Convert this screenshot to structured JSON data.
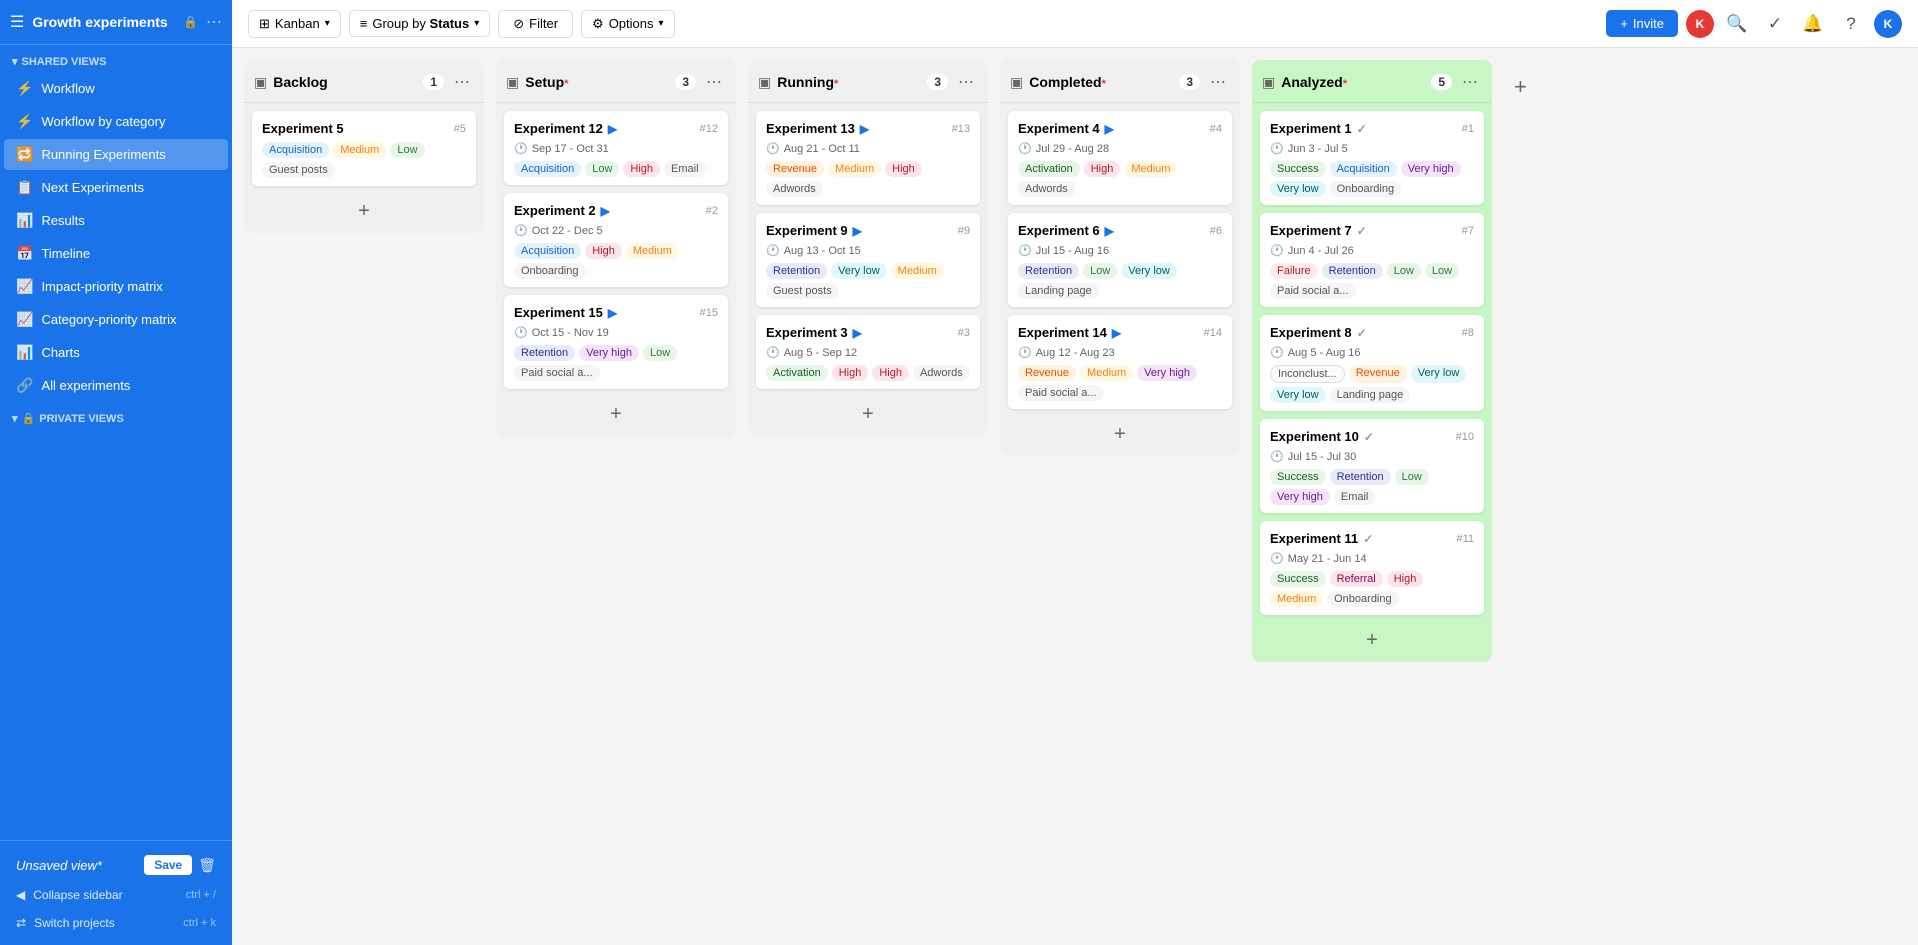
{
  "app": {
    "title": "Growth experiments",
    "title_icon": "🔒"
  },
  "topbar": {
    "kanban_label": "Kanban",
    "group_by_label": "Group by",
    "group_by_field": "Status",
    "filter_label": "Filter",
    "options_label": "Options",
    "invite_label": "Invite"
  },
  "sidebar": {
    "shared_views_label": "SHARED VIEWS",
    "private_views_label": "PRIVATE VIEWS",
    "items": [
      {
        "id": "workflow",
        "label": "Workflow",
        "icon": "⚡"
      },
      {
        "id": "workflow-category",
        "label": "Workflow by category",
        "icon": "⚡"
      },
      {
        "id": "running",
        "label": "Running Experiments",
        "icon": "🔁",
        "active": true
      },
      {
        "id": "next",
        "label": "Next Experiments",
        "icon": "📋"
      },
      {
        "id": "results",
        "label": "Results",
        "icon": "📊"
      },
      {
        "id": "timeline",
        "label": "Timeline",
        "icon": "📅"
      },
      {
        "id": "impact-matrix",
        "label": "Impact-priority matrix",
        "icon": "📈"
      },
      {
        "id": "category-matrix",
        "label": "Category-priority matrix",
        "icon": "📈"
      },
      {
        "id": "charts",
        "label": "Charts",
        "icon": "📊"
      },
      {
        "id": "all",
        "label": "All experiments",
        "icon": "🔗"
      }
    ],
    "unsaved_label": "Unsaved view*",
    "save_label": "Save",
    "collapse_label": "Collapse sidebar",
    "collapse_shortcut": "ctrl + /",
    "switch_label": "Switch projects",
    "switch_shortcut": "ctrl + k"
  },
  "columns": [
    {
      "id": "backlog",
      "title": "Backlog",
      "count": 1,
      "color": "default",
      "cards": [
        {
          "id": "exp5",
          "title": "Experiment 5",
          "num": "#5",
          "has_play": false,
          "has_check": false,
          "date": null,
          "tags": [
            "Acquisition",
            "Medium",
            "Low",
            "Guest posts"
          ]
        }
      ]
    },
    {
      "id": "setup",
      "title": "Setup",
      "has_asterisk": true,
      "count": 3,
      "color": "default",
      "cards": [
        {
          "id": "exp12",
          "title": "Experiment 12",
          "num": "#12",
          "has_play": true,
          "date": "Sep 17 - Oct 31",
          "tags": [
            "Acquisition",
            "Low",
            "High",
            "Email"
          ]
        },
        {
          "id": "exp2",
          "title": "Experiment 2",
          "num": "#2",
          "has_play": true,
          "date": "Oct 22 - Dec 5",
          "tags": [
            "Acquisition",
            "High",
            "Medium",
            "Onboarding"
          ]
        },
        {
          "id": "exp15",
          "title": "Experiment 15",
          "num": "#15",
          "has_play": true,
          "date": "Oct 15 - Nov 19",
          "tags": [
            "Retention",
            "Very high",
            "Low",
            "Paid social a..."
          ]
        }
      ]
    },
    {
      "id": "running",
      "title": "Running",
      "has_asterisk": true,
      "count": 3,
      "color": "default",
      "cards": [
        {
          "id": "exp13",
          "title": "Experiment 13",
          "num": "#13",
          "has_play": true,
          "date": "Aug 21 - Oct 11",
          "tags": [
            "Revenue",
            "Medium",
            "High",
            "Adwords"
          ]
        },
        {
          "id": "exp9",
          "title": "Experiment 9",
          "num": "#9",
          "has_play": true,
          "date": "Aug 13 - Oct 15",
          "tags": [
            "Retention",
            "Very low",
            "Medium",
            "Guest posts"
          ]
        },
        {
          "id": "exp3",
          "title": "Experiment 3",
          "num": "#3",
          "has_play": true,
          "date": "Aug 5 - Sep 12",
          "tags": [
            "Activation",
            "High",
            "High",
            "Adwords"
          ]
        }
      ]
    },
    {
      "id": "completed",
      "title": "Completed",
      "has_asterisk": true,
      "count": 3,
      "color": "default",
      "cards": [
        {
          "id": "exp4",
          "title": "Experiment 4",
          "num": "#4",
          "has_play": true,
          "date": "Jul 29 - Aug 28",
          "tags": [
            "Activation",
            "High",
            "Medium",
            "Adwords"
          ]
        },
        {
          "id": "exp6",
          "title": "Experiment 6",
          "num": "#6",
          "has_play": true,
          "date": "Jul 15 - Aug 16",
          "tags": [
            "Retention",
            "Low",
            "Very low",
            "Landing page"
          ]
        },
        {
          "id": "exp14",
          "title": "Experiment 14",
          "num": "#14",
          "has_play": true,
          "date": "Aug 12 - Aug 23",
          "tags": [
            "Revenue",
            "Medium",
            "Very high",
            "Paid social a..."
          ]
        }
      ]
    },
    {
      "id": "analyzed",
      "title": "Analyzed",
      "has_asterisk": true,
      "count": 5,
      "color": "green",
      "cards": [
        {
          "id": "exp1",
          "title": "Experiment 1",
          "num": "#1",
          "has_check": true,
          "date": "Jun 3 - Jul 5",
          "tags": [
            "Success",
            "Acquisition",
            "Very high",
            "Very low",
            "Onboarding"
          ]
        },
        {
          "id": "exp7",
          "title": "Experiment 7",
          "num": "#7",
          "has_check": true,
          "date": "Jun 4 - Jul 26",
          "tags": [
            "Failure",
            "Retention",
            "Low",
            "Low",
            "Paid social a..."
          ]
        },
        {
          "id": "exp8",
          "title": "Experiment 8",
          "num": "#8",
          "has_check": true,
          "date": "Aug 5 - Aug 16",
          "tags": [
            "Inconclust...",
            "Revenue",
            "Very low",
            "Very low",
            "Landing page"
          ]
        },
        {
          "id": "exp10",
          "title": "Experiment 10",
          "num": "#10",
          "has_check": true,
          "date": "Jul 15 - Jul 30",
          "tags": [
            "Success",
            "Retention",
            "Low",
            "Very high",
            "Email"
          ]
        },
        {
          "id": "exp11",
          "title": "Experiment 11",
          "num": "#11",
          "has_check": true,
          "date": "May 21 - Jun 14",
          "tags": [
            "Success",
            "Referral",
            "High",
            "Medium",
            "Onboarding"
          ]
        }
      ]
    }
  ]
}
